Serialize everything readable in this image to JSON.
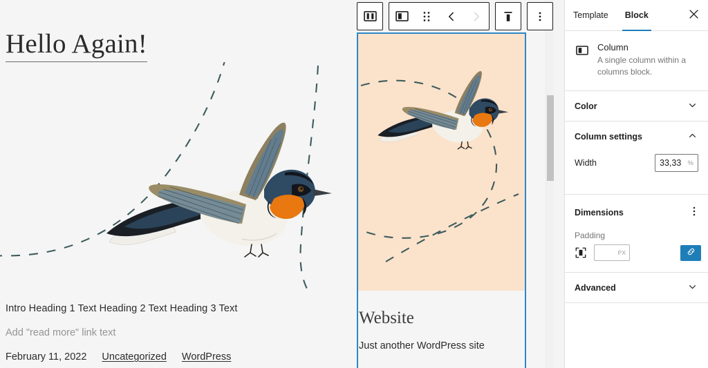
{
  "toolbar": {
    "columns_block_label": "Columns",
    "column_block_label": "Column",
    "drag_label": "Drag",
    "move_left_label": "Move left",
    "move_right_label": "Move right",
    "vertical_align_label": "Change vertical alignment",
    "options_label": "Options"
  },
  "canvas": {
    "page_title": "Hello Again!",
    "excerpt": "Intro Heading 1 Text Heading 2 Text Heading 3 Text",
    "read_more": "Add \"read more\" link text",
    "date": "February 11, 2022",
    "category": "Uncategorized",
    "author": "WordPress",
    "column": {
      "heading": "Website",
      "tagline": "Just another WordPress site"
    },
    "colors": {
      "featured_image_bg": "#fbe2cb",
      "selection_border": "#2b88c8",
      "dash_stroke": "#3d5c5c",
      "canvas_bg": "#f5f5f5"
    }
  },
  "sidebar": {
    "tabs": [
      {
        "label": "Template",
        "active": false
      },
      {
        "label": "Block",
        "active": true
      }
    ],
    "close_label": "Close settings",
    "block_card": {
      "title": "Column",
      "description": "A single column within a columns block.",
      "icon": "column-icon"
    },
    "panels": [
      {
        "label": "Color",
        "expanded": false
      },
      {
        "label": "Column settings",
        "expanded": true
      },
      {
        "label": "Advanced",
        "expanded": false
      }
    ],
    "column_settings": {
      "width_label": "Width",
      "width_value": "33,33",
      "width_unit": "%"
    },
    "dimensions": {
      "label": "Dimensions",
      "more_label": "Dimensions options",
      "padding_label": "Padding",
      "padding_value": "",
      "padding_placeholder": "",
      "padding_unit": "PX",
      "link_sides_label": "Link sides"
    },
    "accent_color": "#1e7eb8"
  }
}
